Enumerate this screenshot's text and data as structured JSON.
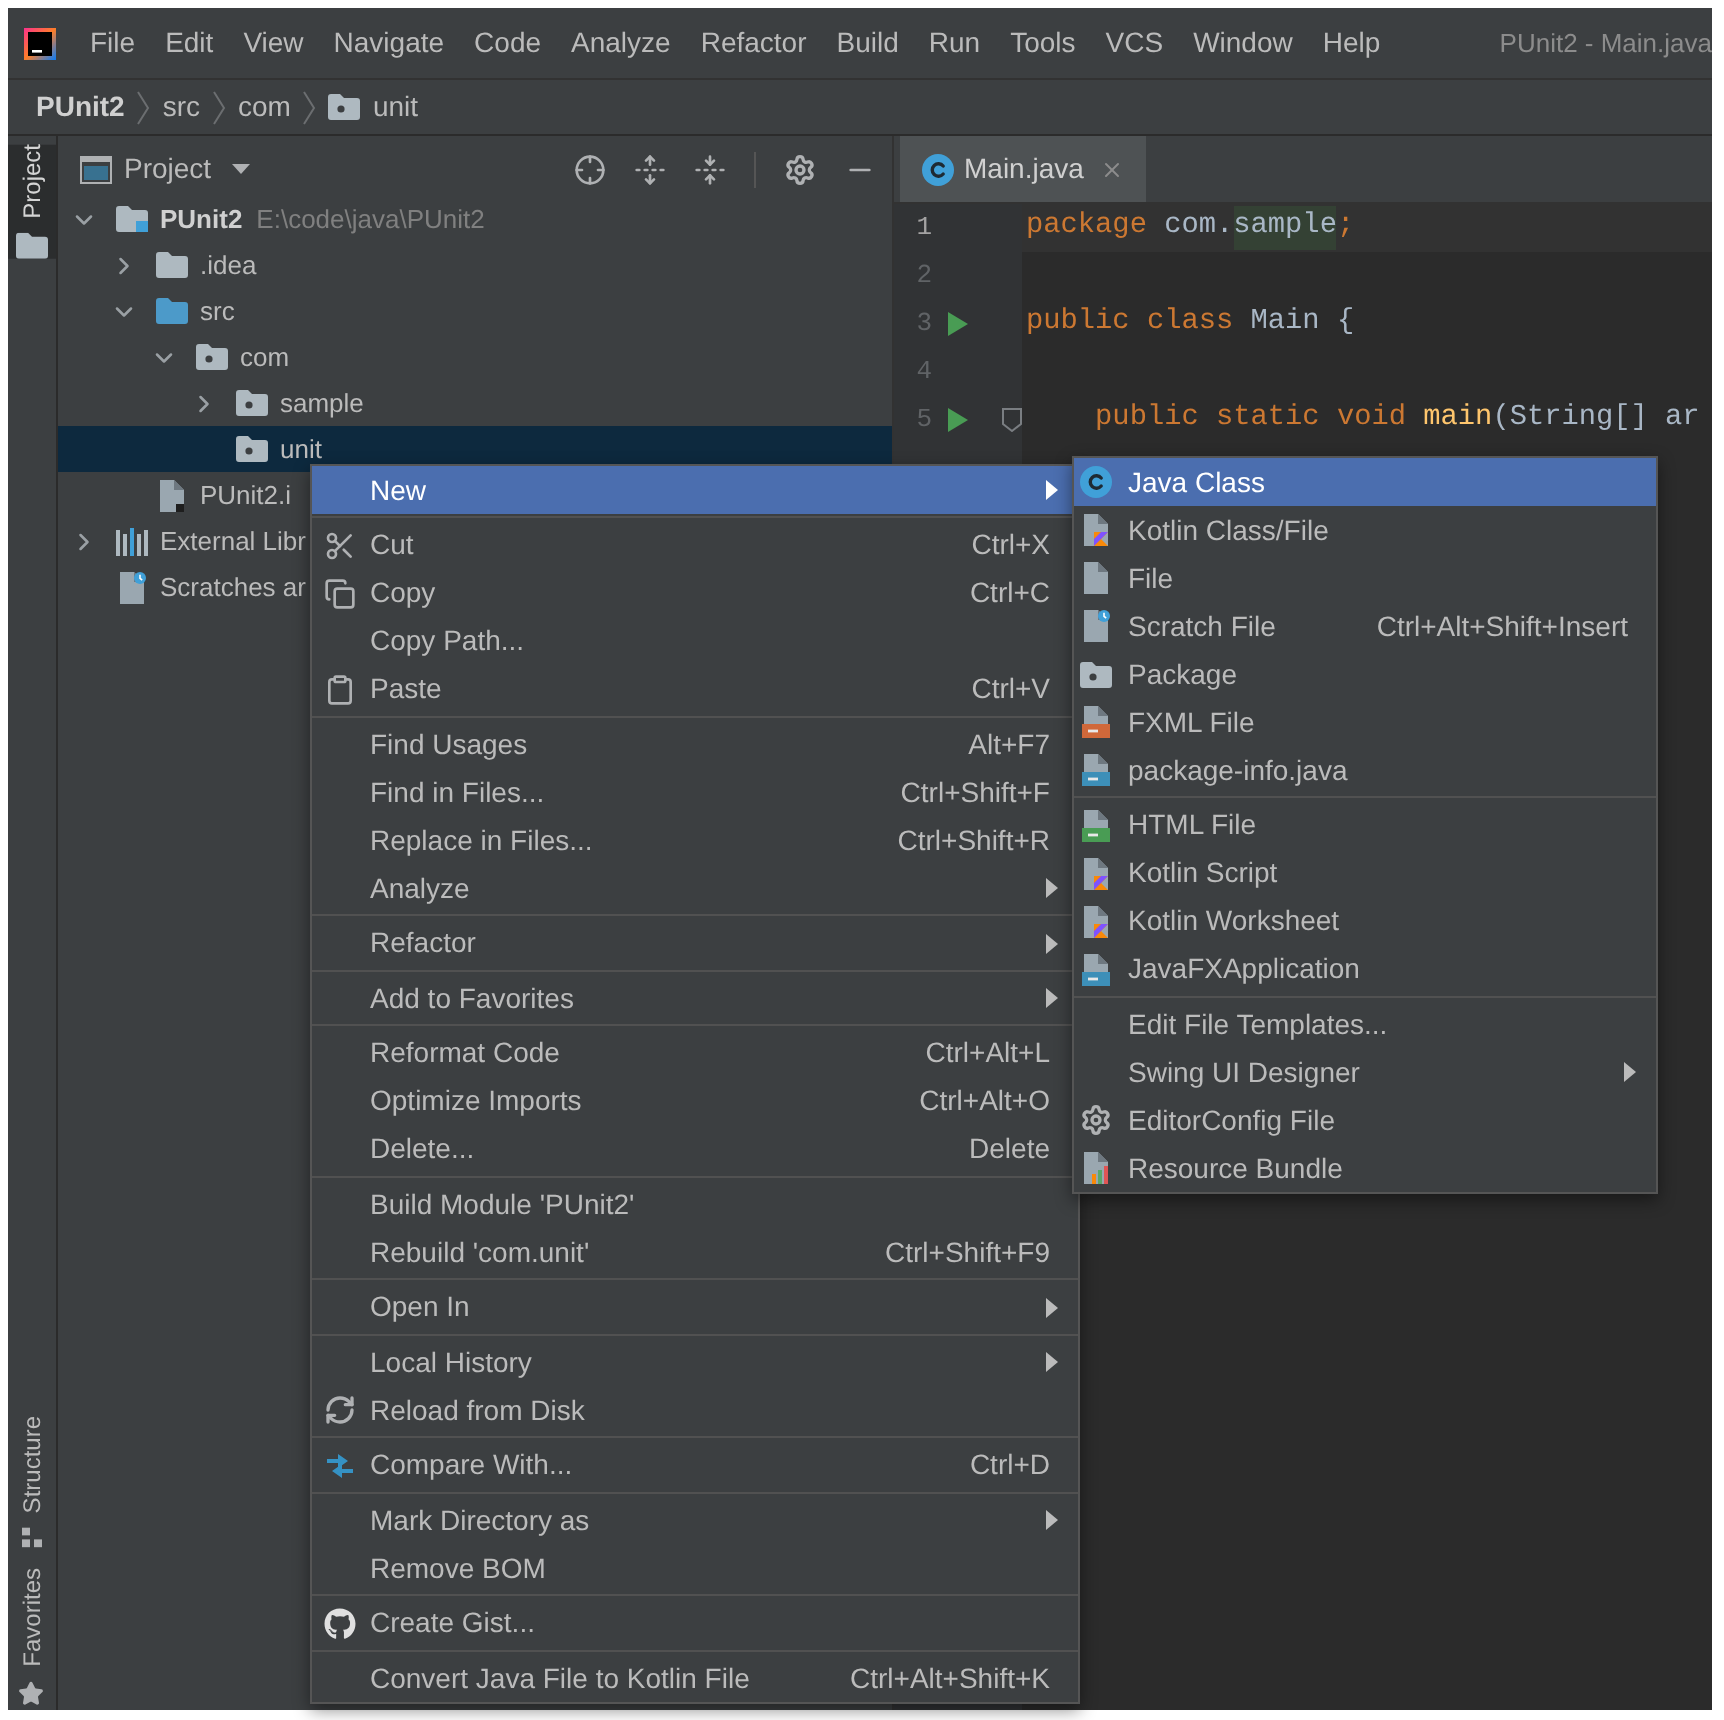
{
  "menu_bar": {
    "items": [
      "File",
      "Edit",
      "View",
      "Navigate",
      "Code",
      "Analyze",
      "Refactor",
      "Build",
      "Run",
      "Tools",
      "VCS",
      "Window",
      "Help"
    ],
    "title": "PUnit2 - Main.java"
  },
  "breadcrumb": [
    {
      "label": "PUnit2",
      "kind": "project"
    },
    {
      "label": "src",
      "kind": "directory"
    },
    {
      "label": "com",
      "kind": "directory"
    },
    {
      "label": "unit",
      "kind": "package"
    }
  ],
  "tool_stripe": {
    "top": [
      {
        "label": "Project",
        "kind": "project",
        "selected": true
      }
    ],
    "bottom": [
      {
        "label": "Structure",
        "kind": "structure",
        "selected": false
      },
      {
        "label": "Favorites",
        "kind": "favorites",
        "selected": false
      }
    ]
  },
  "project_panel": {
    "title": "Project",
    "tree": [
      {
        "label": "PUnit2",
        "path": "E:\\code\\java\\PUnit2",
        "kind": "module",
        "expanded": true,
        "selected": false,
        "children": [
          {
            "label": ".idea",
            "kind": "folder",
            "expanded": false,
            "selected": false
          },
          {
            "label": "src",
            "kind": "source",
            "expanded": true,
            "selected": false,
            "children": [
              {
                "label": "com",
                "kind": "package",
                "expanded": true,
                "selected": false,
                "children": [
                  {
                    "label": "sample",
                    "kind": "package",
                    "expanded": false,
                    "selected": false
                  },
                  {
                    "label": "unit",
                    "kind": "package",
                    "selected": true
                  }
                ]
              }
            ]
          },
          {
            "label": "PUnit2.i",
            "kind": "file",
            "selected": false
          }
        ]
      },
      {
        "label": "External Libr",
        "kind": "libraries",
        "expanded": false,
        "selected": false
      },
      {
        "label": "Scratches ar",
        "kind": "scratches",
        "selected": false
      }
    ]
  },
  "editor": {
    "tabs": [
      {
        "label": "Main.java",
        "selected": true
      }
    ],
    "lines": [
      {
        "number": "1",
        "current": true,
        "run": false,
        "fold": false,
        "tokens": [
          {
            "text": "package",
            "kind": "keyword"
          },
          {
            "text": " com.",
            "kind": "plain"
          },
          {
            "text": "sample",
            "kind": "match"
          },
          {
            "text": ";",
            "kind": "keyword"
          }
        ]
      },
      {
        "number": "2",
        "current": false,
        "run": false,
        "fold": false
      },
      {
        "number": "3",
        "current": false,
        "run": true,
        "fold": false,
        "tokens": [
          {
            "text": "public class",
            "kind": "keyword"
          },
          {
            "text": " Main {",
            "kind": "plain"
          }
        ]
      },
      {
        "number": "4",
        "current": false,
        "run": false,
        "fold": false
      },
      {
        "number": "5",
        "current": false,
        "run": true,
        "fold": true,
        "tokens": [
          {
            "text": "    public static void",
            "kind": "keyword"
          },
          {
            "text": " main",
            "kind": "method"
          },
          {
            "text": "(String[] ar",
            "kind": "plain"
          }
        ]
      }
    ]
  },
  "context_menu": {
    "groups": [
      [
        {
          "label": "New",
          "kind": "plain",
          "selected": true,
          "submenu": true
        }
      ],
      [
        {
          "label": "Cut",
          "kind": "cut",
          "shortcut": "Ctrl+X",
          "selected": false,
          "submenu": false
        },
        {
          "label": "Copy",
          "kind": "copy",
          "shortcut": "Ctrl+C",
          "selected": false,
          "submenu": false
        },
        {
          "label": "Copy Path...",
          "kind": "plain",
          "selected": false,
          "submenu": false
        },
        {
          "label": "Paste",
          "kind": "paste",
          "shortcut": "Ctrl+V",
          "selected": false,
          "submenu": false
        }
      ],
      [
        {
          "label": "Find Usages",
          "kind": "plain",
          "shortcut": "Alt+F7",
          "selected": false,
          "submenu": false
        },
        {
          "label": "Find in Files...",
          "kind": "plain",
          "shortcut": "Ctrl+Shift+F",
          "selected": false,
          "submenu": false
        },
        {
          "label": "Replace in Files...",
          "kind": "plain",
          "shortcut": "Ctrl+Shift+R",
          "selected": false,
          "submenu": false
        },
        {
          "label": "Analyze",
          "kind": "plain",
          "selected": false,
          "submenu": true
        }
      ],
      [
        {
          "label": "Refactor",
          "kind": "plain",
          "selected": false,
          "submenu": true
        }
      ],
      [
        {
          "label": "Add to Favorites",
          "kind": "plain",
          "selected": false,
          "submenu": true
        }
      ],
      [
        {
          "label": "Reformat Code",
          "kind": "plain",
          "shortcut": "Ctrl+Alt+L",
          "selected": false,
          "submenu": false
        },
        {
          "label": "Optimize Imports",
          "kind": "plain",
          "shortcut": "Ctrl+Alt+O",
          "selected": false,
          "submenu": false
        },
        {
          "label": "Delete...",
          "kind": "plain",
          "shortcut": "Delete",
          "selected": false,
          "submenu": false
        }
      ],
      [
        {
          "label": "Build Module 'PUnit2'",
          "kind": "plain",
          "selected": false,
          "submenu": false
        },
        {
          "label": "Rebuild 'com.unit'",
          "kind": "plain",
          "shortcut": "Ctrl+Shift+F9",
          "selected": false,
          "submenu": false
        }
      ],
      [
        {
          "label": "Open In",
          "kind": "plain",
          "selected": false,
          "submenu": true
        }
      ],
      [
        {
          "label": "Local History",
          "kind": "plain",
          "selected": false,
          "submenu": true
        },
        {
          "label": "Reload from Disk",
          "kind": "reload",
          "selected": false,
          "submenu": false
        }
      ],
      [
        {
          "label": "Compare With...",
          "kind": "compare",
          "shortcut": "Ctrl+D",
          "selected": false,
          "submenu": false
        }
      ],
      [
        {
          "label": "Mark Directory as",
          "kind": "plain",
          "selected": false,
          "submenu": true
        },
        {
          "label": "Remove BOM",
          "kind": "plain",
          "selected": false,
          "submenu": false
        }
      ],
      [
        {
          "label": "Create Gist...",
          "kind": "gist",
          "selected": false,
          "submenu": false
        }
      ],
      [
        {
          "label": "Convert Java File to Kotlin File",
          "kind": "plain",
          "shortcut": "Ctrl+Alt+Shift+K",
          "selected": false,
          "submenu": false
        }
      ]
    ]
  },
  "new_submenu": {
    "groups": [
      [
        {
          "label": "Java Class",
          "kind": "class",
          "selected": true,
          "submenu": false
        },
        {
          "label": "Kotlin Class/File",
          "kind": "kotlin",
          "selected": false,
          "submenu": false
        },
        {
          "label": "File",
          "kind": "file",
          "selected": false,
          "submenu": false
        },
        {
          "label": "Scratch File",
          "kind": "scratch",
          "shortcut": "Ctrl+Alt+Shift+Insert",
          "selected": false,
          "submenu": false
        },
        {
          "label": "Package",
          "kind": "package",
          "selected": false,
          "submenu": false
        },
        {
          "label": "FXML File",
          "kind": "fxml",
          "selected": false,
          "submenu": false
        },
        {
          "label": "package-info.java",
          "kind": "javafile",
          "selected": false,
          "submenu": false
        }
      ],
      [
        {
          "label": "HTML File",
          "kind": "html",
          "selected": false,
          "submenu": false
        },
        {
          "label": "Kotlin Script",
          "kind": "kotlinscript",
          "selected": false,
          "submenu": false
        },
        {
          "label": "Kotlin Worksheet",
          "kind": "kotlinscript",
          "selected": false,
          "submenu": false
        },
        {
          "label": "JavaFXApplication",
          "kind": "javafile",
          "selected": false,
          "submenu": false
        }
      ],
      [
        {
          "label": "Edit File Templates...",
          "kind": "plain",
          "selected": false,
          "submenu": false
        },
        {
          "label": "Swing UI Designer",
          "kind": "plain",
          "selected": false,
          "submenu": true
        },
        {
          "label": "EditorConfig File",
          "kind": "config",
          "selected": false,
          "submenu": false
        },
        {
          "label": "Resource Bundle",
          "kind": "bundle",
          "selected": false,
          "submenu": false
        }
      ]
    ]
  }
}
